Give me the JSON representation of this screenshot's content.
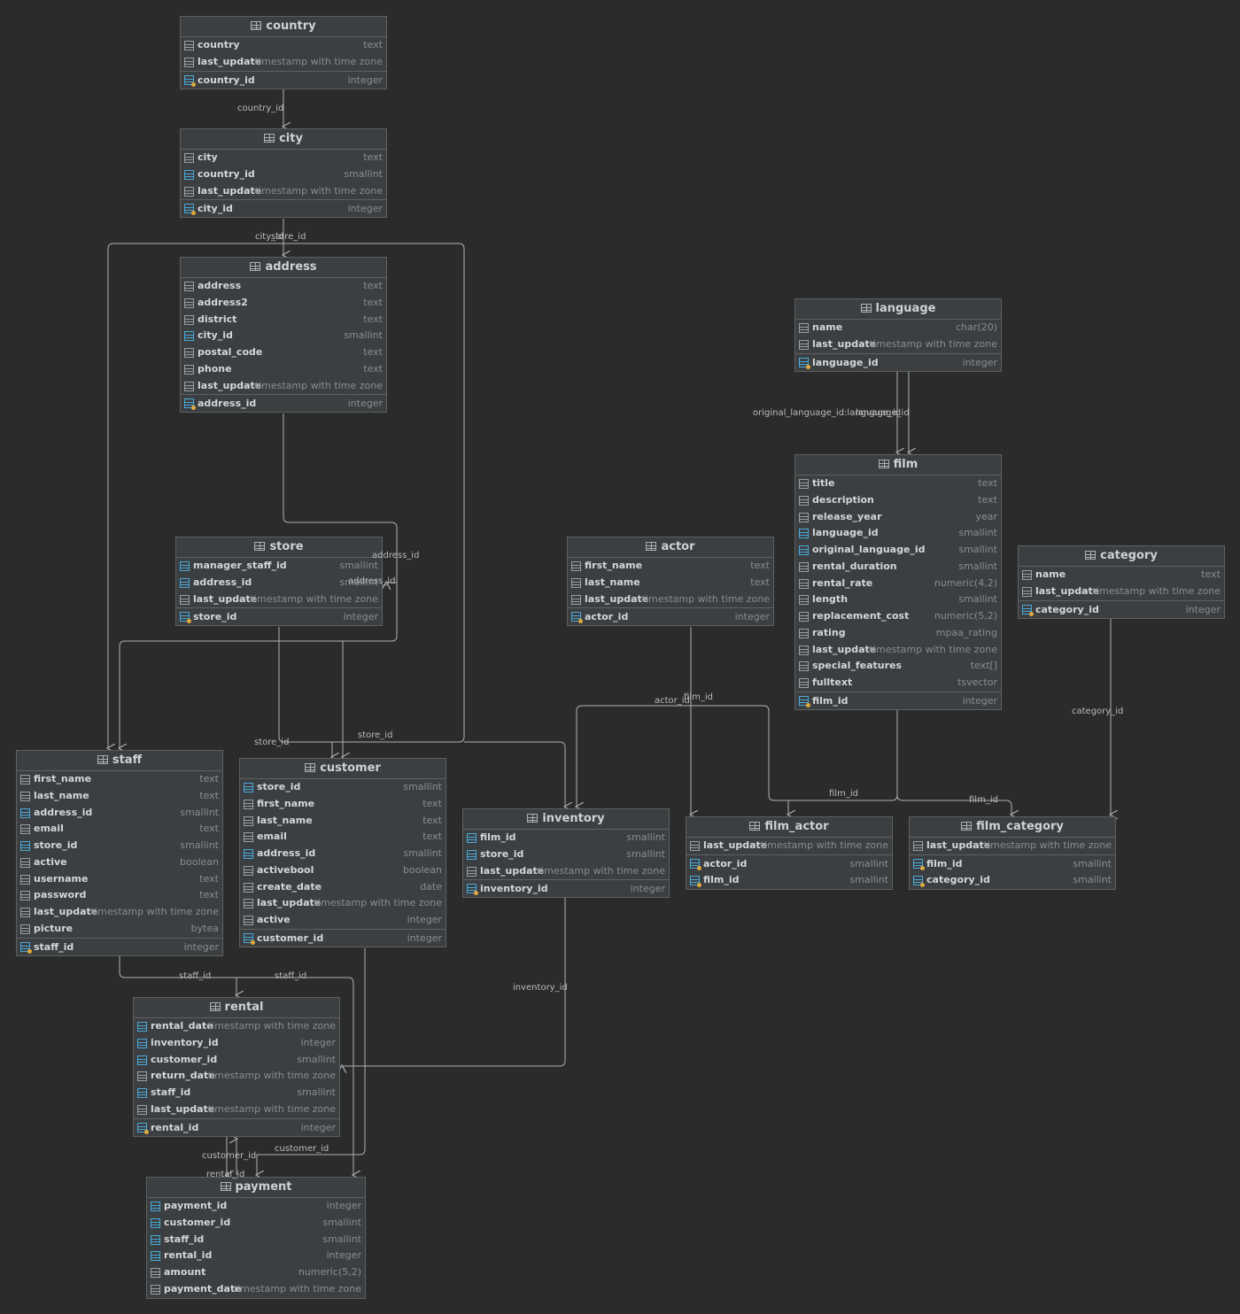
{
  "colors": {
    "background": "#2b2b2b",
    "table_fill": "#3c3f41",
    "table_border": "#5e6060",
    "edge": "#aeb1b3",
    "fk_icon": "#4aa8d8",
    "key_icon": "#e0a93b"
  },
  "tables": [
    {
      "id": "country",
      "name": "country",
      "columns": [
        {
          "name": "country",
          "type": "text",
          "kind": "col"
        },
        {
          "name": "last_update",
          "type": "timestamp with time zone",
          "kind": "col"
        }
      ],
      "pk": {
        "name": "country_id",
        "type": "integer"
      }
    },
    {
      "id": "city",
      "name": "city",
      "columns": [
        {
          "name": "city",
          "type": "text",
          "kind": "col"
        },
        {
          "name": "country_id",
          "type": "smallint",
          "kind": "fk"
        },
        {
          "name": "last_update",
          "type": "timestamp with time zone",
          "kind": "col"
        }
      ],
      "pk": {
        "name": "city_id",
        "type": "integer"
      }
    },
    {
      "id": "address",
      "name": "address",
      "columns": [
        {
          "name": "address",
          "type": "text",
          "kind": "col"
        },
        {
          "name": "address2",
          "type": "text",
          "kind": "col"
        },
        {
          "name": "district",
          "type": "text",
          "kind": "col"
        },
        {
          "name": "city_id",
          "type": "smallint",
          "kind": "fk"
        },
        {
          "name": "postal_code",
          "type": "text",
          "kind": "col"
        },
        {
          "name": "phone",
          "type": "text",
          "kind": "col"
        },
        {
          "name": "last_update",
          "type": "timestamp with time zone",
          "kind": "col"
        }
      ],
      "pk": {
        "name": "address_id",
        "type": "integer"
      }
    },
    {
      "id": "language",
      "name": "language",
      "columns": [
        {
          "name": "name",
          "type": "char(20)",
          "kind": "col"
        },
        {
          "name": "last_update",
          "type": "timestamp with time zone",
          "kind": "col"
        }
      ],
      "pk": {
        "name": "language_id",
        "type": "integer"
      }
    },
    {
      "id": "film",
      "name": "film",
      "columns": [
        {
          "name": "title",
          "type": "text",
          "kind": "col"
        },
        {
          "name": "description",
          "type": "text",
          "kind": "col"
        },
        {
          "name": "release_year",
          "type": "year",
          "kind": "col"
        },
        {
          "name": "language_id",
          "type": "smallint",
          "kind": "fk"
        },
        {
          "name": "original_language_id",
          "type": "smallint",
          "kind": "fk"
        },
        {
          "name": "rental_duration",
          "type": "smallint",
          "kind": "col"
        },
        {
          "name": "rental_rate",
          "type": "numeric(4,2)",
          "kind": "col"
        },
        {
          "name": "length",
          "type": "smallint",
          "kind": "col"
        },
        {
          "name": "replacement_cost",
          "type": "numeric(5,2)",
          "kind": "col"
        },
        {
          "name": "rating",
          "type": "mpaa_rating",
          "kind": "col"
        },
        {
          "name": "last_update",
          "type": "timestamp with time zone",
          "kind": "col"
        },
        {
          "name": "special_features",
          "type": "text[]",
          "kind": "col"
        },
        {
          "name": "fulltext",
          "type": "tsvector",
          "kind": "col"
        }
      ],
      "pk": {
        "name": "film_id",
        "type": "integer"
      }
    },
    {
      "id": "store",
      "name": "store",
      "columns": [
        {
          "name": "manager_staff_id",
          "type": "smallint",
          "kind": "fk"
        },
        {
          "name": "address_id",
          "type": "smallint",
          "kind": "fk"
        },
        {
          "name": "last_update",
          "type": "timestamp with time zone",
          "kind": "col"
        }
      ],
      "pk": {
        "name": "store_id",
        "type": "integer"
      }
    },
    {
      "id": "actor",
      "name": "actor",
      "columns": [
        {
          "name": "first_name",
          "type": "text",
          "kind": "col"
        },
        {
          "name": "last_name",
          "type": "text",
          "kind": "col"
        },
        {
          "name": "last_update",
          "type": "timestamp with time zone",
          "kind": "col"
        }
      ],
      "pk": {
        "name": "actor_id",
        "type": "integer"
      }
    },
    {
      "id": "category",
      "name": "category",
      "columns": [
        {
          "name": "name",
          "type": "text",
          "kind": "col"
        },
        {
          "name": "last_update",
          "type": "timestamp with time zone",
          "kind": "col"
        }
      ],
      "pk": {
        "name": "category_id",
        "type": "integer"
      }
    },
    {
      "id": "staff",
      "name": "staff",
      "columns": [
        {
          "name": "first_name",
          "type": "text",
          "kind": "col"
        },
        {
          "name": "last_name",
          "type": "text",
          "kind": "col"
        },
        {
          "name": "address_id",
          "type": "smallint",
          "kind": "fk"
        },
        {
          "name": "email",
          "type": "text",
          "kind": "col"
        },
        {
          "name": "store_id",
          "type": "smallint",
          "kind": "fk"
        },
        {
          "name": "active",
          "type": "boolean",
          "kind": "col"
        },
        {
          "name": "username",
          "type": "text",
          "kind": "col"
        },
        {
          "name": "password",
          "type": "text",
          "kind": "col"
        },
        {
          "name": "last_update",
          "type": "timestamp with time zone",
          "kind": "col"
        },
        {
          "name": "picture",
          "type": "bytea",
          "kind": "col"
        }
      ],
      "pk": {
        "name": "staff_id",
        "type": "integer"
      }
    },
    {
      "id": "customer",
      "name": "customer",
      "columns": [
        {
          "name": "store_id",
          "type": "smallint",
          "kind": "fk"
        },
        {
          "name": "first_name",
          "type": "text",
          "kind": "col"
        },
        {
          "name": "last_name",
          "type": "text",
          "kind": "col"
        },
        {
          "name": "email",
          "type": "text",
          "kind": "col"
        },
        {
          "name": "address_id",
          "type": "smallint",
          "kind": "fk"
        },
        {
          "name": "activebool",
          "type": "boolean",
          "kind": "col"
        },
        {
          "name": "create_date",
          "type": "date",
          "kind": "col"
        },
        {
          "name": "last_update",
          "type": "timestamp with time zone",
          "kind": "col"
        },
        {
          "name": "active",
          "type": "integer",
          "kind": "col"
        }
      ],
      "pk": {
        "name": "customer_id",
        "type": "integer"
      }
    },
    {
      "id": "inventory",
      "name": "inventory",
      "columns": [
        {
          "name": "film_id",
          "type": "smallint",
          "kind": "fk"
        },
        {
          "name": "store_id",
          "type": "smallint",
          "kind": "fk"
        },
        {
          "name": "last_update",
          "type": "timestamp with time zone",
          "kind": "col"
        }
      ],
      "pk": {
        "name": "inventory_id",
        "type": "integer"
      }
    },
    {
      "id": "film_actor",
      "name": "film_actor",
      "columns": [
        {
          "name": "last_update",
          "type": "timestamp with time zone",
          "kind": "col"
        }
      ],
      "pk_rows": [
        {
          "name": "actor_id",
          "type": "smallint"
        },
        {
          "name": "film_id",
          "type": "smallint"
        }
      ]
    },
    {
      "id": "film_category",
      "name": "film_category",
      "columns": [
        {
          "name": "last_update",
          "type": "timestamp with time zone",
          "kind": "col"
        }
      ],
      "pk_rows": [
        {
          "name": "film_id",
          "type": "smallint"
        },
        {
          "name": "category_id",
          "type": "smallint"
        }
      ]
    },
    {
      "id": "rental",
      "name": "rental",
      "columns": [
        {
          "name": "rental_date",
          "type": "timestamp with time zone",
          "kind": "fk"
        },
        {
          "name": "inventory_id",
          "type": "integer",
          "kind": "fk"
        },
        {
          "name": "customer_id",
          "type": "smallint",
          "kind": "fk"
        },
        {
          "name": "return_date",
          "type": "timestamp with time zone",
          "kind": "col"
        },
        {
          "name": "staff_id",
          "type": "smallint",
          "kind": "fk"
        },
        {
          "name": "last_update",
          "type": "timestamp with time zone",
          "kind": "col"
        }
      ],
      "pk": {
        "name": "rental_id",
        "type": "integer"
      }
    },
    {
      "id": "payment",
      "name": "payment",
      "columns": [
        {
          "name": "payment_id",
          "type": "integer",
          "kind": "fk"
        },
        {
          "name": "customer_id",
          "type": "smallint",
          "kind": "fk"
        },
        {
          "name": "staff_id",
          "type": "smallint",
          "kind": "fk"
        },
        {
          "name": "rental_id",
          "type": "integer",
          "kind": "fk"
        },
        {
          "name": "amount",
          "type": "numeric(5,2)",
          "kind": "col"
        },
        {
          "name": "payment_date",
          "type": "timestamp with time zone",
          "kind": "col"
        }
      ]
    }
  ],
  "edge_labels": [
    "country_id",
    "city_id",
    "store_id",
    "original_language_id:language_id",
    "language_id",
    "address_id",
    "address_id",
    "actor_id",
    "film_id",
    "category_id",
    "store_id",
    "store_id",
    "film_id",
    "film_id",
    "staff_id",
    "staff_id",
    "inventory_id",
    "customer_id",
    "customer_id",
    "rental_id"
  ]
}
